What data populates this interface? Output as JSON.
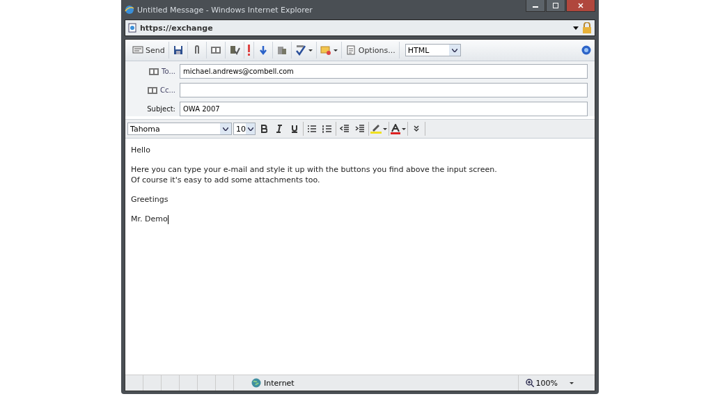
{
  "window": {
    "title": "Untitled Message - Windows Internet Explorer"
  },
  "address_bar": {
    "url": "https://exchange"
  },
  "toolbar": [
    {
      "kind": "send",
      "label": "Send"
    },
    {
      "kind": "save"
    },
    {
      "kind": "attach"
    },
    {
      "kind": "book"
    },
    {
      "kind": "check"
    },
    {
      "kind": "high"
    },
    {
      "kind": "low"
    },
    {
      "kind": "perm"
    },
    {
      "kind": "spell",
      "menu": true
    },
    {
      "kind": "flag",
      "menu": true
    },
    {
      "kind": "options",
      "label": "Options..."
    }
  ],
  "format_select": {
    "value": "HTML"
  },
  "header": {
    "to_label": "To...",
    "to": "michael.andrews@combell.com",
    "cc_label": "Cc...",
    "subject_label": "Subject:",
    "subject": "OWA 2007"
  },
  "format_bar": {
    "font": "Tahoma",
    "size": "10"
  },
  "body": [
    {
      "lines": [
        "Hello"
      ]
    },
    {
      "lines": [
        "Here you can type your e-mail and style it up with the buttons you find above the input screen.",
        "Of course it's easy to add some attachments too."
      ]
    },
    {
      "lines": [
        "Greetings"
      ]
    },
    {
      "lines": [
        "Mr. Demo"
      ]
    }
  ],
  "status_bar": {
    "zone": "Internet",
    "zoom": "100%"
  }
}
